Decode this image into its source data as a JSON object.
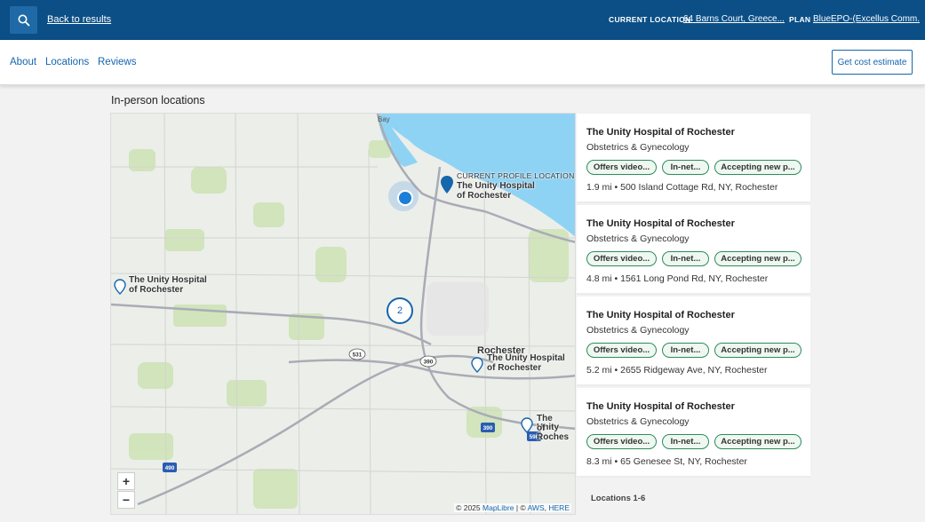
{
  "header": {
    "back_link": "Back to results",
    "current_location_label": "CURRENT LOCATION",
    "current_location_value": "64 Barns Court, Greece...",
    "plan_label": "PLAN",
    "plan_value": "BlueEPO-(Excellus Comm..."
  },
  "nav": {
    "tabs": [
      "About",
      "Locations",
      "Reviews"
    ],
    "cost_button": "Get cost estimate"
  },
  "section_title": "In-person locations",
  "map": {
    "labels": {
      "current_profile": "CURRENT PROFILE LOCATION",
      "hospital_line1": "The Unity Hospital",
      "hospital_line2": "of Rochester",
      "hospital_short_line1": "The Unity",
      "hospital_short_line2": "of Roches",
      "rochester": "Rochester",
      "bay": "Bay"
    },
    "cluster_count": "2",
    "zoom_in": "+",
    "zoom_out": "−",
    "attribution_prefix": "© 2025",
    "attribution_maplibre": "MapLibre",
    "attribution_sep": "| ©",
    "attribution_aws": "AWS",
    "attribution_comma": ",",
    "attribution_here": "HERE",
    "shields": [
      "531",
      "390",
      "390",
      "590",
      "490"
    ]
  },
  "locations": [
    {
      "name": "The Unity Hospital of Rochester",
      "specialty": "Obstetrics & Gynecology",
      "tags": [
        "Offers video...",
        "In-net...",
        "Accepting new p..."
      ],
      "distance": "1.9 mi • 500 Island Cottage Rd, NY, Rochester"
    },
    {
      "name": "The Unity Hospital of Rochester",
      "specialty": "Obstetrics & Gynecology",
      "tags": [
        "Offers video...",
        "In-net...",
        "Accepting new p..."
      ],
      "distance": "4.8 mi • 1561 Long Pond Rd, NY, Rochester"
    },
    {
      "name": "The Unity Hospital of Rochester",
      "specialty": "Obstetrics & Gynecology",
      "tags": [
        "Offers video...",
        "In-net...",
        "Accepting new p..."
      ],
      "distance": "5.2 mi • 2655 Ridgeway Ave, NY, Rochester"
    },
    {
      "name": "The Unity Hospital of Rochester",
      "specialty": "Obstetrics & Gynecology",
      "tags": [
        "Offers video...",
        "In-net...",
        "Accepting new p..."
      ],
      "distance": "8.3 mi • 65 Genesee St, NY, Rochester"
    }
  ],
  "locations_count": "Locations 1-6",
  "colors": {
    "header_bg": "#0b4f86",
    "link": "#1466ad",
    "pill_border": "#2f8b5c",
    "water": "#8fd3f4"
  }
}
